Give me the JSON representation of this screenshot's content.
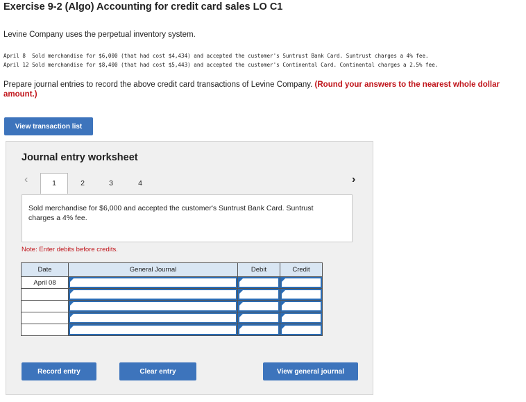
{
  "page": {
    "title": "Exercise 9-2 (Algo) Accounting for credit card sales LO C1",
    "intro": "Levine Company uses the perpetual inventory system.",
    "transactions": [
      "April 8  Sold merchandise for $6,000 (that had cost $4,434) and accepted the customer's Suntrust Bank Card. Suntrust charges a 4% fee.",
      "April 12 Sold merchandise for $8,400 (that had cost $5,443) and accepted the customer's Continental Card. Continental charges a 2.5% fee."
    ],
    "instructions_plain": "Prepare journal entries to record the above credit card transactions of Levine Company. ",
    "instructions_bold": "(Round your answers to the nearest whole dollar amount.)",
    "view_transaction_btn": "View transaction list"
  },
  "worksheet": {
    "title": "Journal entry worksheet",
    "prev_icon": "‹",
    "next_icon": "›",
    "tabs": [
      "1",
      "2",
      "3",
      "4"
    ],
    "active_tab": 0,
    "description": "Sold merchandise for $6,000 and accepted the customer's Suntrust Bank Card. Suntrust charges a 4% fee.",
    "note": "Note: Enter debits before credits.",
    "columns": {
      "date": "Date",
      "journal": "General Journal",
      "debit": "Debit",
      "credit": "Credit"
    },
    "rows": [
      {
        "date": "April 08"
      },
      {
        "date": ""
      },
      {
        "date": ""
      },
      {
        "date": ""
      },
      {
        "date": ""
      }
    ],
    "record_btn": "Record entry",
    "clear_btn": "Clear entry",
    "view_journal_btn": "View general journal"
  },
  "colors": {
    "button_blue": "#3d74bc",
    "header_blue": "#d9e6f3",
    "note_red": "#c0141a"
  }
}
